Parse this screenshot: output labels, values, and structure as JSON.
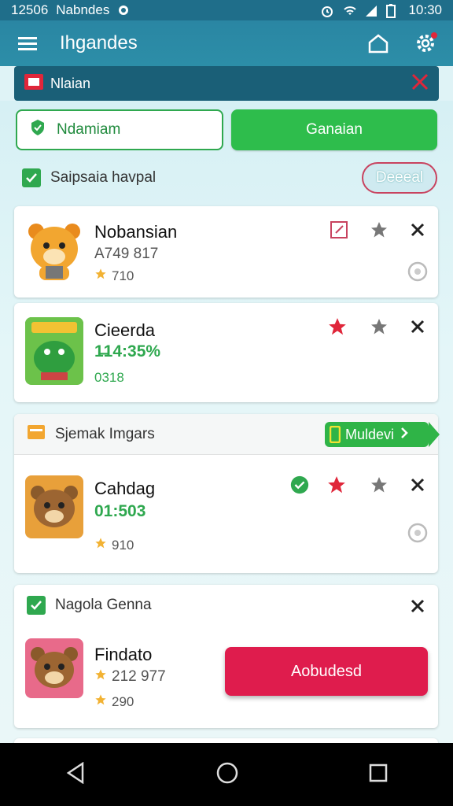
{
  "status_bar": {
    "left_text": "12506",
    "app_name": "Nabndes",
    "time": "10:30"
  },
  "app_bar": {
    "title": "Ihgandes"
  },
  "sub_bar": {
    "text": "Nlaian"
  },
  "buttons": {
    "outline_label": "Ndamiam",
    "solid_label": "Ganaian"
  },
  "filter": {
    "label": "Saipsaia havpal",
    "pill_label": "Deeeal"
  },
  "cards": [
    {
      "name": "Nobansian",
      "sub1": "A749 817",
      "sub2": "710"
    },
    {
      "name": "Cieerda",
      "sub1": "1̶14:35%",
      "sub2": "0318"
    }
  ],
  "section1": {
    "header": "Sjemak Imgars",
    "chip": "Muldevi",
    "item": {
      "name": "Cahdag",
      "sub1": "01:503",
      "sub2": "910"
    }
  },
  "section2": {
    "header": "Nagola Genna",
    "item": {
      "name": "Findato",
      "sub1": "212 977",
      "sub2": "290"
    }
  },
  "fab_label": "Aobudesd",
  "colors": {
    "primary": "#2a86a3",
    "green": "#2ebd4c",
    "accent": "#df1c4d",
    "star_red": "#e0263a"
  }
}
